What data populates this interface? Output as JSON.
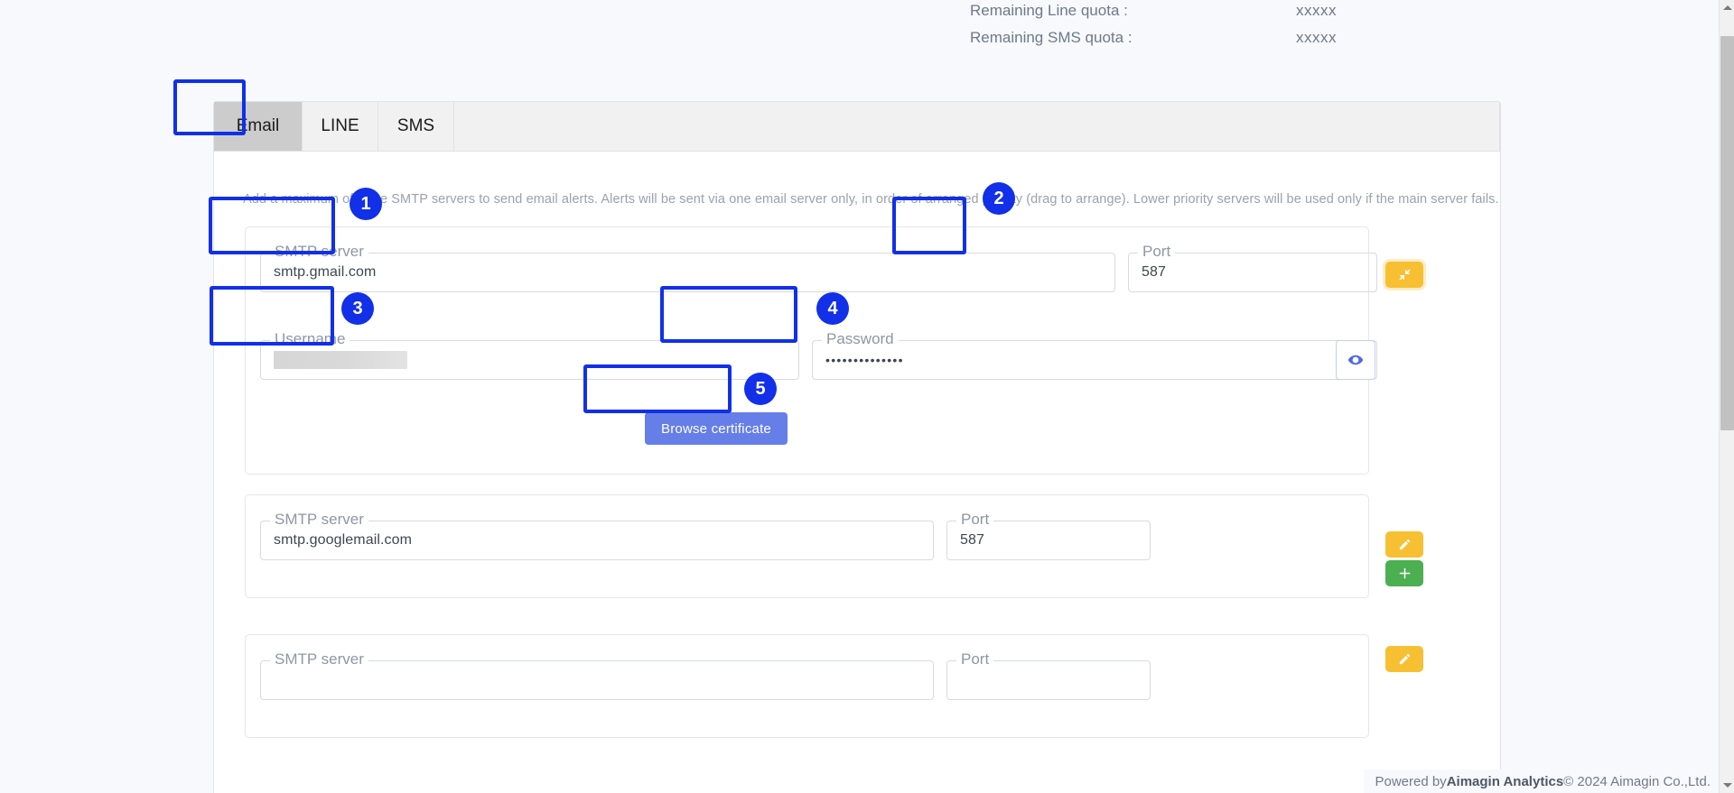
{
  "quota": {
    "rows": [
      {
        "label": "Remaining Line quota :",
        "value": "xxxxx"
      },
      {
        "label": "Remaining SMS quota :",
        "value": "xxxxx"
      }
    ]
  },
  "tabs": [
    {
      "id": "email",
      "label": "Email",
      "active": true
    },
    {
      "id": "line",
      "label": "LINE",
      "active": false
    },
    {
      "id": "sms",
      "label": "SMS",
      "active": false
    }
  ],
  "panel": {
    "description": "Add a maximum of three SMTP servers to send email alerts. Alerts will be sent via one email server only, in order of arranged priority (drag to arrange). Lower priority servers will be used only if the main server fails."
  },
  "servers": [
    {
      "smtp_label": "SMTP server",
      "smtp_value": "smtp.gmail.com",
      "port_label": "Port",
      "port_value": "587",
      "username_label": "Username",
      "username_value": "",
      "password_label": "Password",
      "password_value": "••••••••••••••",
      "browse_label": "Browse certificate",
      "reveal_icon": "eye-icon",
      "action_icon": "collapse-arrows-icon"
    },
    {
      "smtp_label": "SMTP server",
      "smtp_value": "smtp.googlemail.com",
      "port_label": "Port",
      "port_value": "587",
      "edit_icon": "pencil-icon",
      "add_icon": "plus-icon"
    },
    {
      "smtp_label": "SMTP server",
      "smtp_value": "",
      "port_label": "Port",
      "port_value": "",
      "edit_icon": "pencil-icon"
    }
  ],
  "annotations": [
    {
      "n": "1",
      "target": "smtp-server-field-1"
    },
    {
      "n": "2",
      "target": "port-field-1"
    },
    {
      "n": "3",
      "target": "username-field-1"
    },
    {
      "n": "4",
      "target": "password-field-1"
    },
    {
      "n": "5",
      "target": "browse-certificate-button"
    }
  ],
  "footer": {
    "prefix": "Powered by ",
    "brand": "Aimagin Analytics",
    "suffix": " © 2024 Aimagin Co.,Ltd."
  },
  "colors": {
    "accent_blue": "#1130e8",
    "button_blue": "#667ee8",
    "warn_yellow": "#f7c033",
    "add_green": "#4caf50",
    "background": "#f8f9fd"
  }
}
